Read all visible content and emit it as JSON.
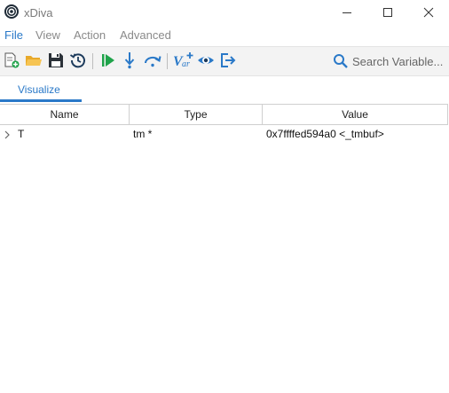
{
  "window": {
    "title": "xDiva"
  },
  "menu": {
    "items": [
      "File",
      "View",
      "Action",
      "Advanced"
    ]
  },
  "toolbar": {
    "search_placeholder": "Search Variable..."
  },
  "tabs": [
    {
      "label": "Visualize",
      "selected": true
    }
  ],
  "table": {
    "columns": [
      "Name",
      "Type",
      "Value"
    ],
    "rows": [
      {
        "name": "T",
        "type": "tm *",
        "value": "0x7ffffed594a0 <_tmbuf>",
        "expanded": false
      }
    ]
  },
  "colors": {
    "accent": "#2a79c8",
    "play_green": "#1fa34a",
    "toolbar_bg": "#f3f3f3"
  }
}
